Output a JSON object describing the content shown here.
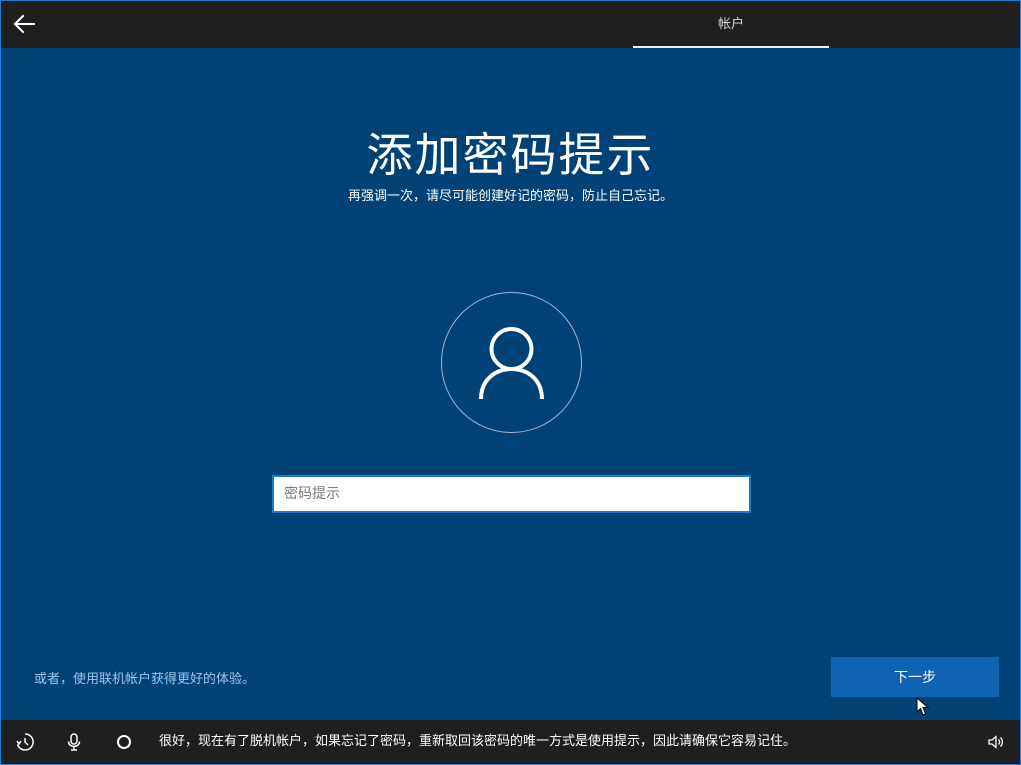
{
  "topbar": {
    "back_icon": "arrow-left-icon",
    "tab_label": "帐户"
  },
  "main": {
    "title": "添加密码提示",
    "subtitle": "再强调一次，请尽可能创建好记的密码，防止自己忘记。",
    "avatar_icon": "user-icon",
    "hint_field": {
      "placeholder": "密码提示",
      "value": ""
    },
    "online_account_link": "或者，使用联机帐户获得更好的体验。",
    "next_button": "下一步"
  },
  "bottombar": {
    "icons": [
      "accessibility-icon",
      "microphone-icon",
      "cortana-icon",
      "volume-icon"
    ],
    "narration": "很好，现在有了脱机帐户，如果忘记了密码，重新取回该密码的唯一方式是使用提示，因此请确保它容易记住。"
  },
  "colors": {
    "background": "#004275",
    "bar": "#1f1f1f",
    "accent_button": "#0f63b0",
    "link": "#9cc7ee"
  }
}
